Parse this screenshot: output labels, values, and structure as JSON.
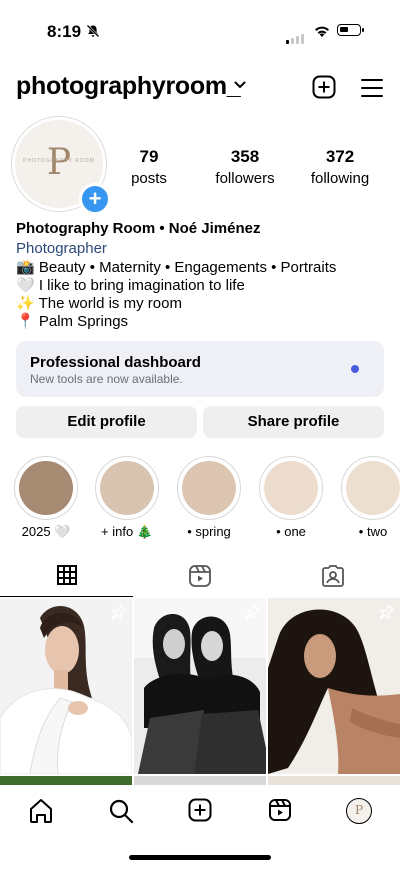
{
  "status": {
    "time": "8:19"
  },
  "header": {
    "username": "photographyroom_"
  },
  "profile": {
    "avatar_letter": "P",
    "avatar_brand_text": "PHOTOGRAPHY ROOM",
    "stats": [
      {
        "value": "79",
        "label": "posts"
      },
      {
        "value": "358",
        "label": "followers"
      },
      {
        "value": "372",
        "label": "following"
      }
    ],
    "name": "Photography Room • Noé Jiménez",
    "category": "Photographer",
    "bio_lines": [
      "📸 Beauty • Maternity • Engagements • Portraits",
      "🤍 I like to bring imagination to life",
      "✨ The world is my room",
      "📍 Palm Springs"
    ]
  },
  "dashboard": {
    "title": "Professional dashboard",
    "subtitle": "New tools are now available."
  },
  "buttons": {
    "edit": "Edit profile",
    "share": "Share profile"
  },
  "highlights": [
    {
      "label": "2025 🤍",
      "color": "#a68a72"
    },
    {
      "label": "+ info 🎄",
      "color": "#d8c4b0"
    },
    {
      "label": "• spring",
      "color": "#dcc6b2"
    },
    {
      "label": "• one",
      "color": "#ecdccd"
    },
    {
      "label": "• two",
      "color": "#eddfd0"
    }
  ],
  "tabs": [
    "grid-icon",
    "reels-icon",
    "tagged-icon"
  ],
  "nav": [
    "home-icon",
    "search-icon",
    "create-icon",
    "reels-icon",
    "profile-avatar"
  ],
  "colors": {
    "accent": "#3797f0",
    "dashboard_dot": "#4a5be0",
    "category": "#2b4a7a"
  }
}
